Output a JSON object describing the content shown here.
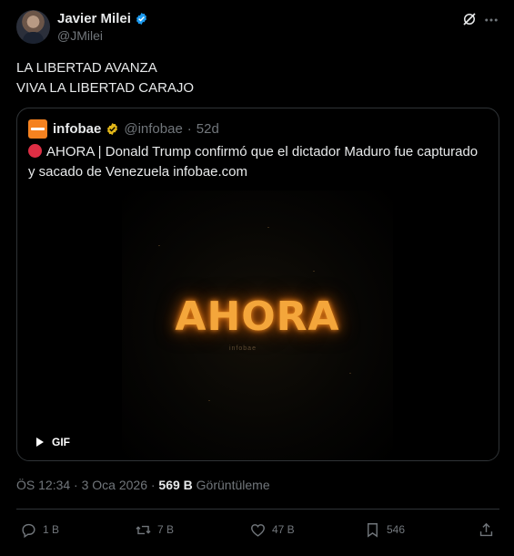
{
  "author": {
    "name": "Javier Milei",
    "handle": "@JMilei"
  },
  "tweet": {
    "lines": [
      "LA LIBERTAD AVANZA",
      "VIVA LA LIBERTAD CARAJO"
    ]
  },
  "quote": {
    "name": "infobae",
    "handle": "@infobae",
    "separator": "·",
    "time": "52d",
    "text": "AHORA | Donald Trump confirmó que el dictador Maduro fue capturado y sacado de Venezuela infobae.com",
    "media": {
      "word": "AHORA",
      "subtext": "infobae",
      "badge": "GIF"
    }
  },
  "meta": {
    "timestamp": "ÖS 12:34 · 3 Oca 2026 · ",
    "views_count": "569 B",
    "views_label": " Görüntüleme"
  },
  "actions": {
    "replies": "1 B",
    "reposts": "7 B",
    "likes": "47 B",
    "bookmarks": "546"
  },
  "colors": {
    "background": "#000000",
    "text": "#e7e9ea",
    "muted": "#71767b",
    "verified": "#1d9bf0",
    "quote_verified": "#e2b719",
    "infobae_orange": "#f58220",
    "border": "#2f3336"
  },
  "icons": [
    "verified-icon",
    "grok-icon",
    "more-icon",
    "infobae-logo",
    "red-circle-icon",
    "play-icon",
    "reply-icon",
    "repost-icon",
    "like-icon",
    "bookmark-icon",
    "share-icon"
  ]
}
